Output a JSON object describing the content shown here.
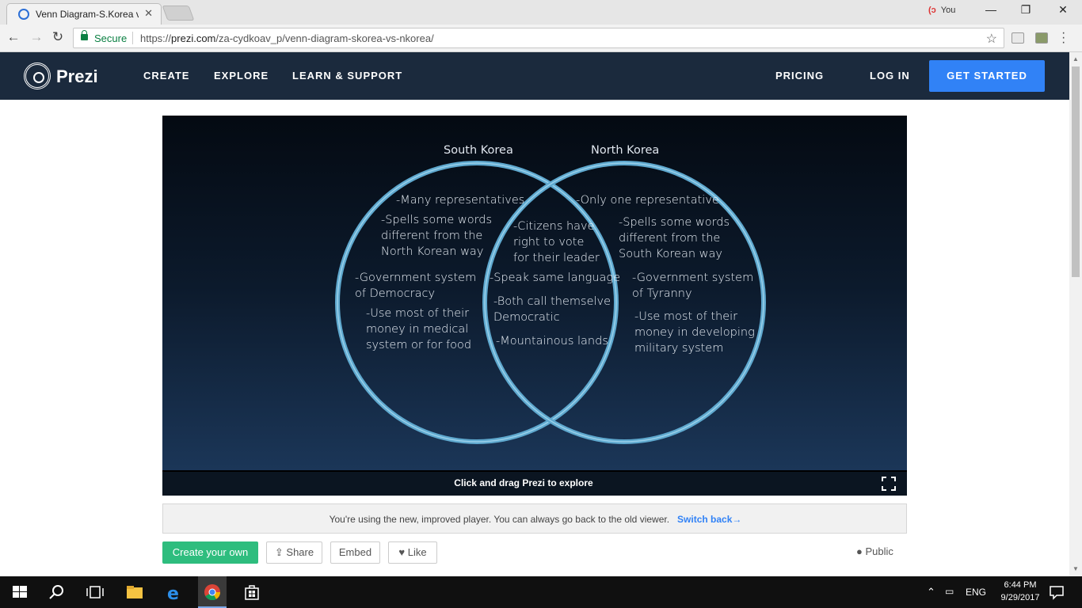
{
  "browser": {
    "tab_title": "Venn Diagram-S.Korea vs",
    "tab_close": "✕",
    "user_label": "You",
    "secure_label": "Secure",
    "url_scheme": "https://",
    "url_host": "prezi.com",
    "url_path": "/za-cydkoav_p/venn-diagram-skorea-vs-nkorea/"
  },
  "header": {
    "logo": "Prezi",
    "nav": [
      "CREATE",
      "EXPLORE",
      "LEARN & SUPPORT"
    ],
    "pricing": "PRICING",
    "login": "LOG IN",
    "get_started": "GET STARTED"
  },
  "diagram": {
    "left_title": "South Korea",
    "right_title": "North Korea",
    "left_items": [
      "-Many representatives",
      "-Spells some words",
      "different from the",
      "North Korean way",
      "-Government system",
      "of Democracy",
      "-Use most of their",
      "money in medical",
      "system or for food"
    ],
    "center_items": [
      "-Citizens have",
      "right to vote",
      "for their leader",
      "-Speak same language",
      "-Both call themselve",
      "Democratic",
      "-Mountainous lands"
    ],
    "right_items": [
      "-Only one representative",
      "-Spells some words",
      "different from the",
      "South Korean way",
      "-Government system",
      "of Tyranny",
      "-Use most of their",
      "money in developing",
      "military system"
    ]
  },
  "viewer": {
    "hint": "Click and drag Prezi to explore"
  },
  "notice": {
    "text": "You're using the new, improved player. You can always go back to the old viewer.",
    "link": "Switch back→"
  },
  "actions": {
    "create": "Create your own",
    "share": "Share",
    "embed": "Embed",
    "like": "Like",
    "visibility": "Public"
  },
  "taskbar": {
    "language": "ENG",
    "time": "6:44 PM",
    "date": "9/29/2017"
  }
}
